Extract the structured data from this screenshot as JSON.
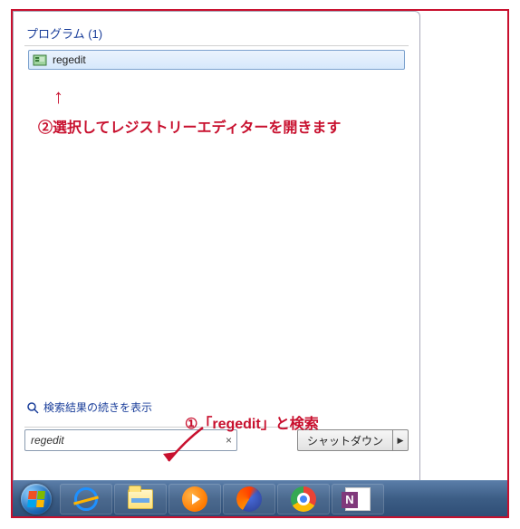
{
  "start_menu": {
    "section_header": "プログラム (1)",
    "results": [
      {
        "icon": "regedit-icon",
        "label": "regedit"
      }
    ],
    "more_results_label": "検索結果の続きを表示",
    "search_value": "regedit",
    "shutdown_label": "シャットダウン"
  },
  "annotations": {
    "step1": "①「regedit」と検索",
    "step2": "②選択してレジストリーエディターを開きます",
    "up_arrow": "↑"
  },
  "taskbar": {
    "items": [
      "start",
      "ie",
      "explorer",
      "wmp",
      "firefox",
      "chrome",
      "onenote"
    ]
  }
}
